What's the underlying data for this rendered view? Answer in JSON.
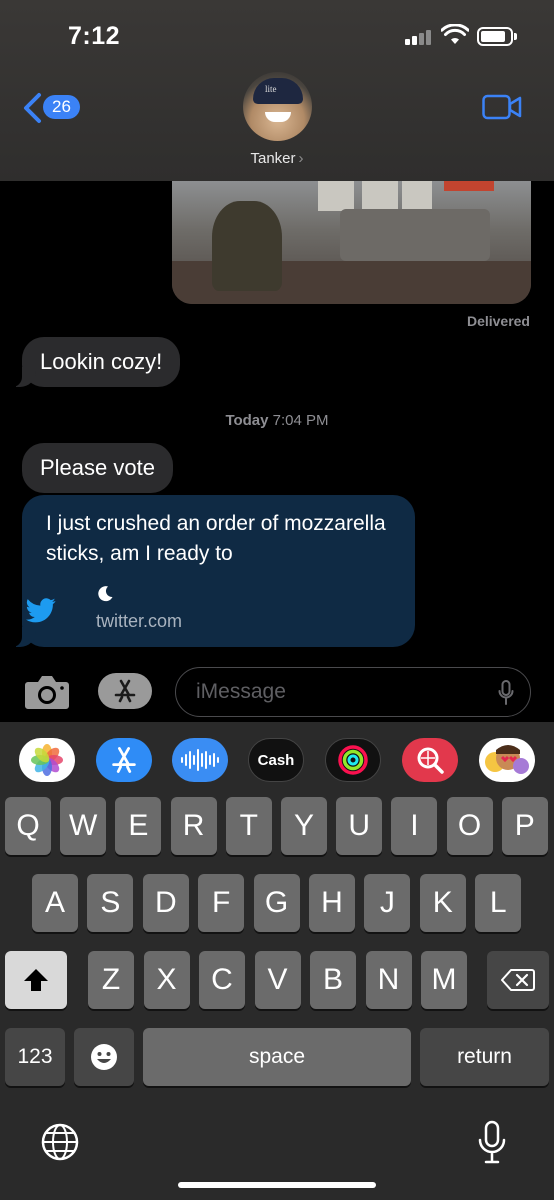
{
  "status": {
    "time": "7:12"
  },
  "header": {
    "back_count": "26",
    "contact_name": "Tanker",
    "avatar_cap_text": "lite"
  },
  "messages": {
    "delivered": "Delivered",
    "msg1": "Lookin cozy!",
    "timestamp_day": "Today",
    "timestamp_time": "7:04 PM",
    "msg2": "Please vote",
    "link_text": "I just crushed an order of mozzarella sticks, am I ready to",
    "link_domain": "twitter.com"
  },
  "compose": {
    "placeholder": "iMessage"
  },
  "app_strip": [
    {
      "name": "photos",
      "icon": "photos-icon"
    },
    {
      "name": "app-store",
      "icon": "app-store-icon"
    },
    {
      "name": "audio",
      "icon": "audio-waveform-icon"
    },
    {
      "name": "cash",
      "label": "Cash"
    },
    {
      "name": "activity",
      "icon": "activity-rings-icon"
    },
    {
      "name": "search",
      "icon": "images-search-icon"
    },
    {
      "name": "memoji",
      "icon": "memoji-icon"
    }
  ],
  "keyboard": {
    "row1": [
      "Q",
      "W",
      "E",
      "R",
      "T",
      "Y",
      "U",
      "I",
      "O",
      "P"
    ],
    "row2": [
      "A",
      "S",
      "D",
      "F",
      "G",
      "H",
      "J",
      "K",
      "L"
    ],
    "row3": [
      "Z",
      "X",
      "C",
      "V",
      "B",
      "N",
      "M"
    ],
    "numbers": "123",
    "space": "space",
    "return": "return"
  },
  "colors": {
    "accent": "#3b82f6",
    "bubble_in": "#2b2b2d",
    "link_card": "#0f2a44",
    "twitter": "#1d9bf0"
  }
}
